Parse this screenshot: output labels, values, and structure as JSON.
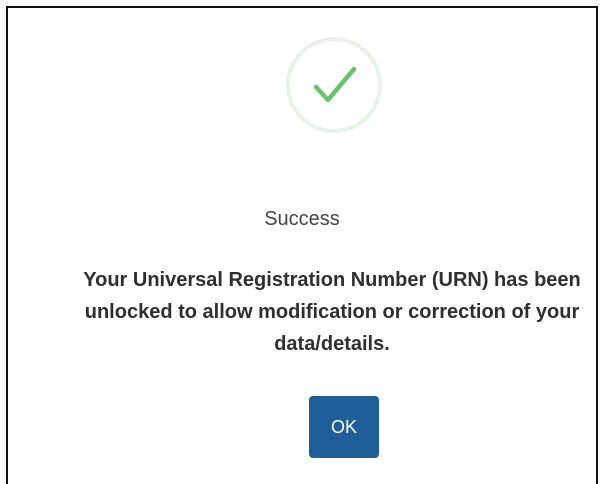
{
  "dialog": {
    "icon": "check-icon",
    "title": "Success",
    "message": "Your Universal Registration Number (URN) has been unlocked to allow modification or correction of your data/details.",
    "ok_label": "OK"
  },
  "colors": {
    "check": "#6cc26a",
    "icon_ring": "#e6f3e6",
    "button": "#1f5f99",
    "text": "#2f2f2f"
  }
}
